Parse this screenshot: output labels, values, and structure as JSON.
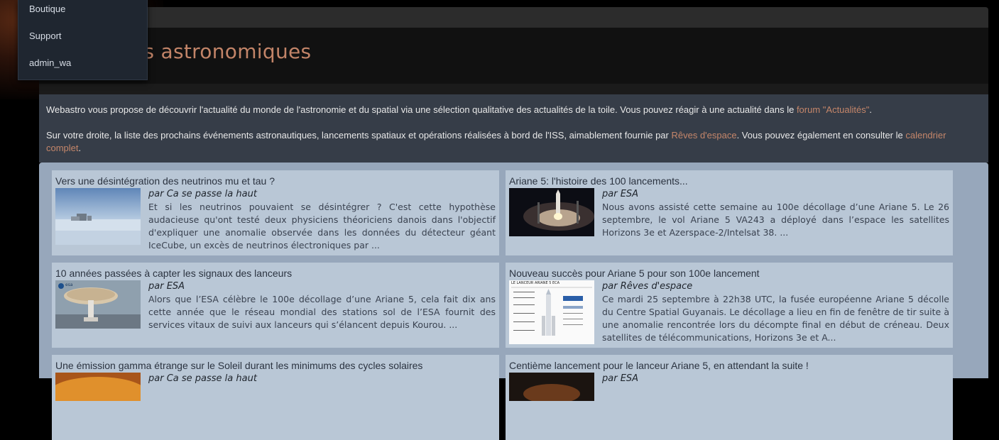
{
  "menu": {
    "items": [
      {
        "label": "Boutique"
      },
      {
        "label": "Support"
      },
      {
        "label": "admin_wa"
      }
    ]
  },
  "header": {
    "title": "Actualités astronomiques"
  },
  "intro": {
    "p1_text": "Webastro vous propose de découvrir l'actualité du monde de l'astronomie et du spatial via une sélection qualitative des actualités de la toile. Vous pouvez réagir à une actualité dans le ",
    "p1_link": "forum \"Actualités\"",
    "p1_end": ".",
    "p2_text": "Sur votre droite, la liste des prochains événements astronautiques, lancements spatiaux et opérations réalisées à bord de l'ISS, aimablement fournie par ",
    "p2_link1": "Rêves d'espace",
    "p2_mid": ". Vous pouvez également en consulter le ",
    "p2_link2": "calendrier complet",
    "p2_end": "."
  },
  "news": [
    {
      "title": "Vers une désintégration des neutrinos mu et tau ?",
      "author": "par Ca se passe la haut",
      "excerpt": "Et si les neutrinos pouvaient se désintégrer ? C'est cette hypothèse audacieuse qu'ont testé deux physiciens théoriciens danois dans l'objectif d'expliquer une anomalie observée dans les données du détecteur géant IceCube, un excès de neutrinos électroniques par ..."
    },
    {
      "title": "Ariane 5: l'histoire des 100 lancements...",
      "author": "par ESA",
      "excerpt": "Nous avons assisté cette semaine au 100e décollage d’une Ariane 5. Le 26 septembre, le vol Ariane 5 VA243 a déployé dans l’espace les satellites Horizons 3e et Azerspace-2/Intelsat 38. ..."
    },
    {
      "title": "10 années passées à capter les signaux des lanceurs",
      "author": "par ESA",
      "excerpt": "Alors que l’ESA célèbre le 100e décollage d’une Ariane 5, cela fait dix ans cette année que le réseau mondial des stations sol de l’ESA fournit des services vitaux de suivi aux lanceurs qui s’élancent depuis Kourou. ..."
    },
    {
      "title": "Nouveau succès pour Ariane 5 pour son 100e lancement",
      "author": "par Rêves d'espace",
      "excerpt": "Ce mardi 25 septembre à 22h38 UTC, la fusée européenne Ariane 5 décolle du Centre Spatial Guyanais. Le décollage a lieu en fin de fenêtre de tir suite à une anomalie rencontrée lors du décompte final en début de créneau. Deux satellites de télécommunications, Horizons 3e et A..."
    },
    {
      "title": "Une émission gamma étrange sur le Soleil durant les minimums des cycles solaires",
      "author": "par Ca se passe la haut",
      "excerpt": ""
    },
    {
      "title": "Centième lancement pour le lanceur Ariane 5, en attendant la suite !",
      "author": "par ESA",
      "excerpt": ""
    }
  ],
  "thumb_labels": {
    "esa_mark": "esa",
    "doc_header": "LE LANCEUR ARIANE 5 ECA"
  },
  "colors": {
    "link": "#c5866a",
    "title": "#c28468",
    "card_bg": "#b9c7d6",
    "news_bg": "#97a7bb",
    "intro_bg": "#363d48"
  }
}
